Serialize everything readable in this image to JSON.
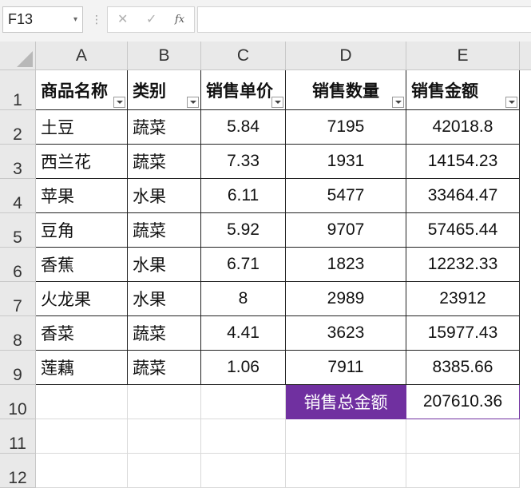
{
  "formula_bar": {
    "name_box": "F13",
    "dropdown_icon": "▾",
    "separator": "⋮",
    "cancel_icon": "✕",
    "confirm_icon": "✓",
    "fx_label": "fx",
    "formula": ""
  },
  "columns": [
    "A",
    "B",
    "C",
    "D",
    "E"
  ],
  "rows": [
    "1",
    "2",
    "3",
    "4",
    "5",
    "6",
    "7",
    "8",
    "9",
    "10",
    "11",
    "12"
  ],
  "headers": {
    "name": "商品名称",
    "category": "类别",
    "price": "销售单价",
    "qty": "销售数量",
    "amount": "销售金额"
  },
  "data_rows": [
    {
      "name": "土豆",
      "category": "蔬菜",
      "price": "5.84",
      "qty": "7195",
      "amount": "42018.8"
    },
    {
      "name": "西兰花",
      "category": "蔬菜",
      "price": "7.33",
      "qty": "1931",
      "amount": "14154.23"
    },
    {
      "name": "苹果",
      "category": "水果",
      "price": "6.11",
      "qty": "5477",
      "amount": "33464.47"
    },
    {
      "name": "豆角",
      "category": "蔬菜",
      "price": "5.92",
      "qty": "9707",
      "amount": "57465.44"
    },
    {
      "name": "香蕉",
      "category": "水果",
      "price": "6.71",
      "qty": "1823",
      "amount": "12232.33"
    },
    {
      "name": "火龙果",
      "category": "水果",
      "price": "8",
      "qty": "2989",
      "amount": "23912"
    },
    {
      "name": "香菜",
      "category": "蔬菜",
      "price": "4.41",
      "qty": "3623",
      "amount": "15977.43"
    },
    {
      "name": "莲藕",
      "category": "蔬菜",
      "price": "1.06",
      "qty": "7911",
      "amount": "8385.66"
    }
  ],
  "total": {
    "label": "销售总金额",
    "value": "207610.36"
  },
  "colors": {
    "total_label_bg": "#7030a0"
  }
}
